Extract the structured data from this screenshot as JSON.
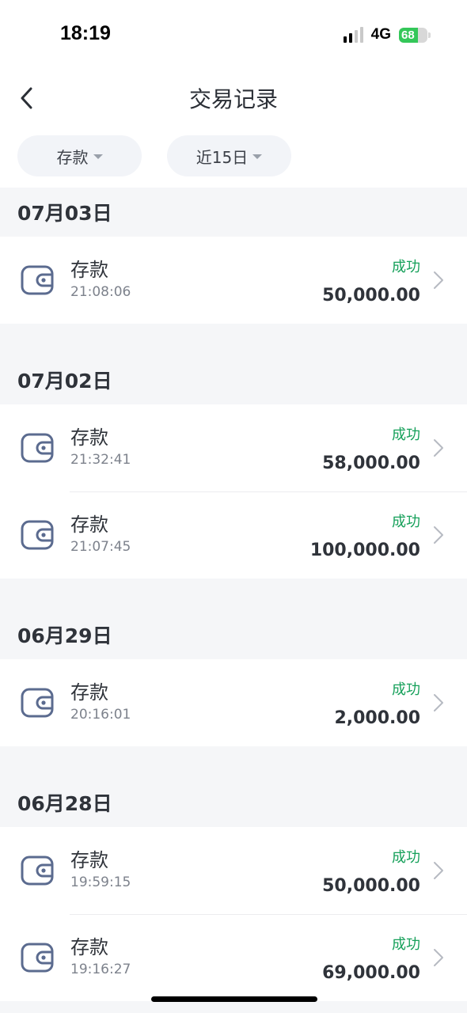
{
  "status_bar": {
    "time": "18:19",
    "network": "4G",
    "battery_level": "68",
    "battery_color": "#34c759"
  },
  "nav": {
    "back_icon": "chevron-left-icon",
    "title": "交易记录"
  },
  "filters": {
    "type_label": "存款",
    "range_label": "近15日"
  },
  "colors": {
    "success": "#16a05a",
    "icon": "#5b6b8f"
  },
  "groups": [
    {
      "date": "07月03日",
      "items": [
        {
          "title": "存款",
          "time": "21:08:06",
          "status": "成功",
          "amount": "50,000.00"
        }
      ]
    },
    {
      "date": "07月02日",
      "items": [
        {
          "title": "存款",
          "time": "21:32:41",
          "status": "成功",
          "amount": "58,000.00"
        },
        {
          "title": "存款",
          "time": "21:07:45",
          "status": "成功",
          "amount": "100,000.00"
        }
      ]
    },
    {
      "date": "06月29日",
      "items": [
        {
          "title": "存款",
          "time": "20:16:01",
          "status": "成功",
          "amount": "2,000.00"
        }
      ]
    },
    {
      "date": "06月28日",
      "items": [
        {
          "title": "存款",
          "time": "19:59:15",
          "status": "成功",
          "amount": "50,000.00"
        },
        {
          "title": "存款",
          "time": "19:16:27",
          "status": "成功",
          "amount": "69,000.00"
        }
      ]
    }
  ]
}
